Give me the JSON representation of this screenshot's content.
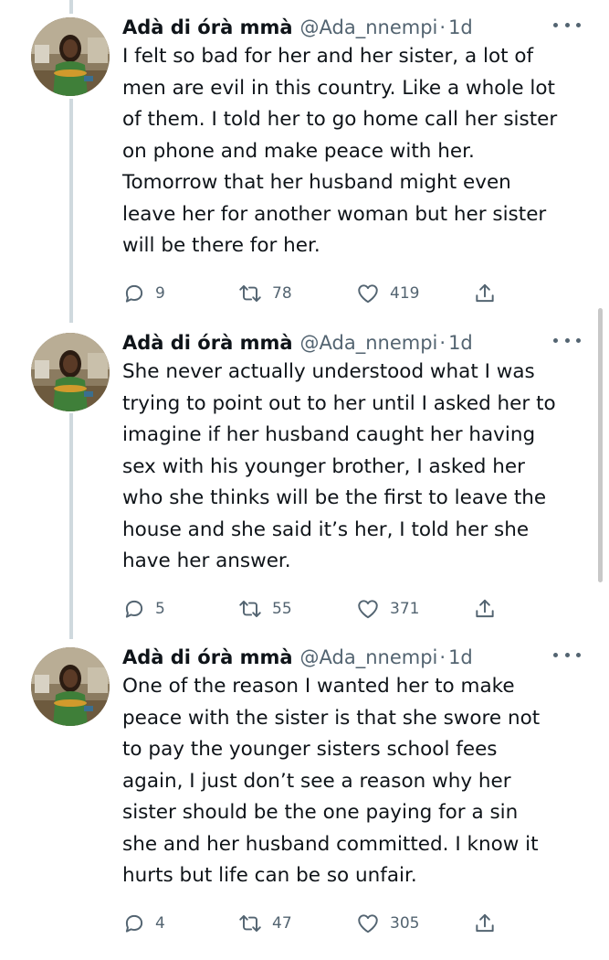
{
  "tweets": [
    {
      "author": {
        "display_name": "Adà di órà mmà",
        "handle": "@Ada_nnempi"
      },
      "separator": "·",
      "time": "1d",
      "text": "I felt so bad for her and her sister, a lot of\nmen are evil in this country. Like a whole lot\nof them. I told her to go home call her sister\non phone and make peace with her.\nTomorrow that her husband might even\nleave her for another woman but her sister\nwill be there for her.",
      "stats": {
        "replies": "9",
        "retweets": "78",
        "likes": "419"
      }
    },
    {
      "author": {
        "display_name": "Adà di órà mmà",
        "handle": "@Ada_nnempi"
      },
      "separator": "·",
      "time": "1d",
      "text": "She never actually understood what I was\ntrying to point out to her until I asked her to\nimagine if her husband caught her having\nsex with his younger brother, I asked her\nwho she thinks will be the first to leave the\nhouse and she said it’s her, I told her she\nhave her answer.",
      "stats": {
        "replies": "5",
        "retweets": "55",
        "likes": "371"
      }
    },
    {
      "author": {
        "display_name": "Adà di órà mmà",
        "handle": "@Ada_nnempi"
      },
      "separator": "·",
      "time": "1d",
      "text": "One of the reason I wanted her to make\npeace with the sister is that she swore not\nto pay the younger sisters school fees\nagain, I just don’t see a reason why her\nsister should be the one paying for a sin\nshe and her husband committed. I know it\nhurts but life can be so unfair.",
      "stats": {
        "replies": "4",
        "retweets": "47",
        "likes": "305"
      }
    }
  ],
  "icons": {
    "reply": "reply-icon",
    "retweet": "retweet-icon",
    "like": "heart-icon",
    "share": "share-icon",
    "more": "more-horizontal-icon"
  },
  "colors": {
    "text_primary": "#0f1419",
    "text_secondary": "#536471",
    "thread_line": "#cfd9de",
    "background": "#ffffff"
  }
}
